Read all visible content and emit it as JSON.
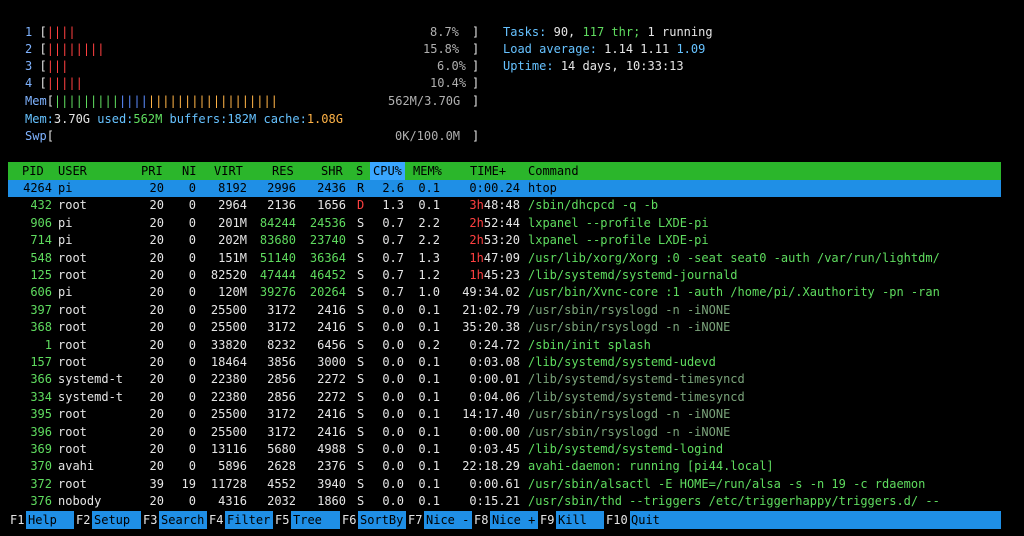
{
  "meters": {
    "cpus": [
      {
        "num": "1",
        "bar": "||||",
        "pct": "8.7%"
      },
      {
        "num": "2",
        "bar": "||||||||",
        "pct": "15.8%"
      },
      {
        "num": "3",
        "bar": "|||",
        "pct": "6.0%"
      },
      {
        "num": "4",
        "bar": "|||||",
        "pct": "10.4%"
      }
    ],
    "mem": {
      "label": "Mem",
      "value": "562M/3.70G"
    },
    "mem_detail": {
      "total_label": "Mem:",
      "total": "3.70G",
      "used_label": "used:",
      "used": "562M",
      "buffers_label": "buffers:",
      "buffers": "182M",
      "cache_label": "cache:",
      "cache": "1.08G"
    },
    "swp": {
      "label": "Swp",
      "value": "0K/100.0M"
    }
  },
  "summary": {
    "tasks_label": "Tasks:",
    "tasks": "90,",
    "thr": "117 thr;",
    "running": "1 running",
    "load_label": "Load average:",
    "load1": "1.14",
    "load5": "1.11",
    "load15": "1.09",
    "uptime_label": "Uptime:",
    "uptime": "14 days, 10:33:13"
  },
  "columns": {
    "pid": "PID",
    "user": "USER",
    "pri": "PRI",
    "ni": "NI",
    "virt": "VIRT",
    "res": "RES",
    "shr": "SHR",
    "s": "S",
    "cpu": "CPU%",
    "mem": "MEM%",
    "time": "TIME+",
    "cmd": "Command"
  },
  "processes": [
    {
      "pid": "4264",
      "user": "pi",
      "pri": "20",
      "ni": "0",
      "virt": "8192",
      "res": "2996",
      "shr": "2436",
      "s": "R",
      "cpu": "2.6",
      "mem": "0.1",
      "time": "0:00.24",
      "cmd": "htop"
    },
    {
      "pid": "432",
      "user": "root",
      "pri": "20",
      "ni": "0",
      "virt": "2964",
      "res": "2136",
      "shr": "1656",
      "s": "D",
      "cpu": "1.3",
      "mem": "0.1",
      "time": "3h48:48",
      "cmd": "/sbin/dhcpcd -q -b"
    },
    {
      "pid": "906",
      "user": "pi",
      "pri": "20",
      "ni": "0",
      "virt": "201M",
      "res": "84244",
      "shr": "24536",
      "s": "S",
      "cpu": "0.7",
      "mem": "2.2",
      "time": "2h52:44",
      "cmd": "lxpanel --profile LXDE-pi"
    },
    {
      "pid": "714",
      "user": "pi",
      "pri": "20",
      "ni": "0",
      "virt": "202M",
      "res": "83680",
      "shr": "23740",
      "s": "S",
      "cpu": "0.7",
      "mem": "2.2",
      "time": "2h53:20",
      "cmd": "lxpanel --profile LXDE-pi"
    },
    {
      "pid": "548",
      "user": "root",
      "pri": "20",
      "ni": "0",
      "virt": "151M",
      "res": "51140",
      "shr": "36364",
      "s": "S",
      "cpu": "0.7",
      "mem": "1.3",
      "time": "1h47:09",
      "cmd": "/usr/lib/xorg/Xorg :0 -seat seat0 -auth /var/run/lightdm/"
    },
    {
      "pid": "125",
      "user": "root",
      "pri": "20",
      "ni": "0",
      "virt": "82520",
      "res": "47444",
      "shr": "46452",
      "s": "S",
      "cpu": "0.7",
      "mem": "1.2",
      "time": "1h45:23",
      "cmd": "/lib/systemd/systemd-journald"
    },
    {
      "pid": "606",
      "user": "pi",
      "pri": "20",
      "ni": "0",
      "virt": "120M",
      "res": "39276",
      "shr": "20264",
      "s": "S",
      "cpu": "0.7",
      "mem": "1.0",
      "time": "49:34.02",
      "cmd": "/usr/bin/Xvnc-core :1 -auth /home/pi/.Xauthority -pn -ran"
    },
    {
      "pid": "397",
      "user": "root",
      "pri": "20",
      "ni": "0",
      "virt": "25500",
      "res": "3172",
      "shr": "2416",
      "s": "S",
      "cpu": "0.0",
      "mem": "0.1",
      "time": "21:02.79",
      "cmd": "/usr/sbin/rsyslogd -n -iNONE"
    },
    {
      "pid": "368",
      "user": "root",
      "pri": "20",
      "ni": "0",
      "virt": "25500",
      "res": "3172",
      "shr": "2416",
      "s": "S",
      "cpu": "0.0",
      "mem": "0.1",
      "time": "35:20.38",
      "cmd": "/usr/sbin/rsyslogd -n -iNONE"
    },
    {
      "pid": "1",
      "user": "root",
      "pri": "20",
      "ni": "0",
      "virt": "33820",
      "res": "8232",
      "shr": "6456",
      "s": "S",
      "cpu": "0.0",
      "mem": "0.2",
      "time": "0:24.72",
      "cmd": "/sbin/init splash"
    },
    {
      "pid": "157",
      "user": "root",
      "pri": "20",
      "ni": "0",
      "virt": "18464",
      "res": "3856",
      "shr": "3000",
      "s": "S",
      "cpu": "0.0",
      "mem": "0.1",
      "time": "0:03.08",
      "cmd": "/lib/systemd/systemd-udevd"
    },
    {
      "pid": "366",
      "user": "systemd-t",
      "pri": "20",
      "ni": "0",
      "virt": "22380",
      "res": "2856",
      "shr": "2272",
      "s": "S",
      "cpu": "0.0",
      "mem": "0.1",
      "time": "0:00.01",
      "cmd": "/lib/systemd/systemd-timesyncd"
    },
    {
      "pid": "334",
      "user": "systemd-t",
      "pri": "20",
      "ni": "0",
      "virt": "22380",
      "res": "2856",
      "shr": "2272",
      "s": "S",
      "cpu": "0.0",
      "mem": "0.1",
      "time": "0:04.06",
      "cmd": "/lib/systemd/systemd-timesyncd"
    },
    {
      "pid": "395",
      "user": "root",
      "pri": "20",
      "ni": "0",
      "virt": "25500",
      "res": "3172",
      "shr": "2416",
      "s": "S",
      "cpu": "0.0",
      "mem": "0.1",
      "time": "14:17.40",
      "cmd": "/usr/sbin/rsyslogd -n -iNONE"
    },
    {
      "pid": "396",
      "user": "root",
      "pri": "20",
      "ni": "0",
      "virt": "25500",
      "res": "3172",
      "shr": "2416",
      "s": "S",
      "cpu": "0.0",
      "mem": "0.1",
      "time": "0:00.00",
      "cmd": "/usr/sbin/rsyslogd -n -iNONE"
    },
    {
      "pid": "369",
      "user": "root",
      "pri": "20",
      "ni": "0",
      "virt": "13116",
      "res": "5680",
      "shr": "4988",
      "s": "S",
      "cpu": "0.0",
      "mem": "0.1",
      "time": "0:03.45",
      "cmd": "/lib/systemd/systemd-logind"
    },
    {
      "pid": "370",
      "user": "avahi",
      "pri": "20",
      "ni": "0",
      "virt": "5896",
      "res": "2628",
      "shr": "2376",
      "s": "S",
      "cpu": "0.0",
      "mem": "0.1",
      "time": "22:18.29",
      "cmd": "avahi-daemon: running [pi44.local]"
    },
    {
      "pid": "372",
      "user": "root",
      "pri": "39",
      "ni": "19",
      "virt": "11728",
      "res": "4552",
      "shr": "3940",
      "s": "S",
      "cpu": "0.0",
      "mem": "0.1",
      "time": "0:00.61",
      "cmd": "/usr/sbin/alsactl -E HOME=/run/alsa -s -n 19 -c rdaemon"
    },
    {
      "pid": "376",
      "user": "nobody",
      "pri": "20",
      "ni": "0",
      "virt": "4316",
      "res": "2032",
      "shr": "1860",
      "s": "S",
      "cpu": "0.0",
      "mem": "0.1",
      "time": "0:15.21",
      "cmd": "/usr/sbin/thd --triggers /etc/triggerhappy/triggers.d/ --"
    }
  ],
  "footer": [
    {
      "key": "F1",
      "label": "Help"
    },
    {
      "key": "F2",
      "label": "Setup"
    },
    {
      "key": "F3",
      "label": "Search"
    },
    {
      "key": "F4",
      "label": "Filter"
    },
    {
      "key": "F5",
      "label": "Tree"
    },
    {
      "key": "F6",
      "label": "SortBy"
    },
    {
      "key": "F7",
      "label": "Nice -"
    },
    {
      "key": "F8",
      "label": "Nice +"
    },
    {
      "key": "F9",
      "label": "Kill"
    },
    {
      "key": "F10",
      "label": "Quit"
    }
  ],
  "colors": {
    "header_bg": "#2bb62b",
    "selected_bg": "#1f8fe6",
    "footer_bg": "#1f8fe6",
    "green": "#5fdc5f",
    "cyan": "#66c2ff",
    "red": "#ff4040"
  }
}
